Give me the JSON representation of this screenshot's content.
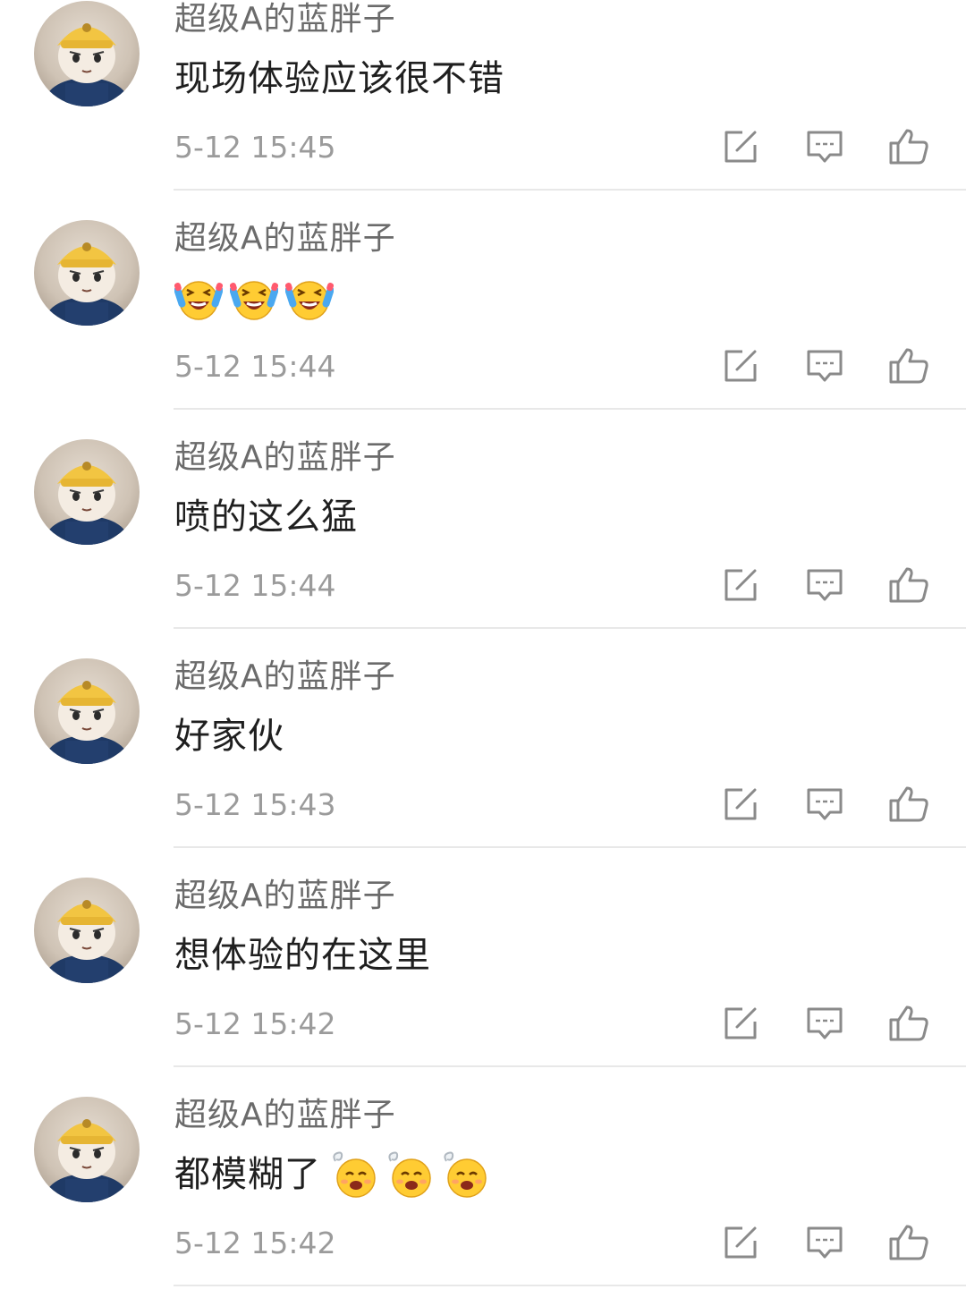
{
  "comments": [
    {
      "user": "超级A的蓝胖子",
      "text": "现场体验应该很不错",
      "emojis": [],
      "time": "5-12 15:45"
    },
    {
      "user": "超级A的蓝胖子",
      "text": "",
      "emojis": [
        "laughing-tears-emoji",
        "laughing-tears-emoji",
        "laughing-tears-emoji"
      ],
      "time": "5-12 15:44"
    },
    {
      "user": "超级A的蓝胖子",
      "text": "喷的这么猛",
      "emojis": [],
      "time": "5-12 15:44"
    },
    {
      "user": "超级A的蓝胖子",
      "text": "好家伙",
      "emojis": [],
      "time": "5-12 15:43"
    },
    {
      "user": "超级A的蓝胖子",
      "text": "想体验的在这里",
      "emojis": [],
      "time": "5-12 15:42"
    },
    {
      "user": "超级A的蓝胖子",
      "text": "都模糊了",
      "emojis": [
        "dizzy-face-emoji",
        "dizzy-face-emoji",
        "dizzy-face-emoji"
      ],
      "time": "5-12 15:42"
    }
  ],
  "actions": [
    "share-icon",
    "reply-icon",
    "like-icon"
  ],
  "colors": {
    "username": "#6b6b6b",
    "text": "#1f1f1f",
    "timestamp": "#9b9b9b",
    "icon": "#8a8a8a",
    "divider": "#e8e8e8"
  }
}
